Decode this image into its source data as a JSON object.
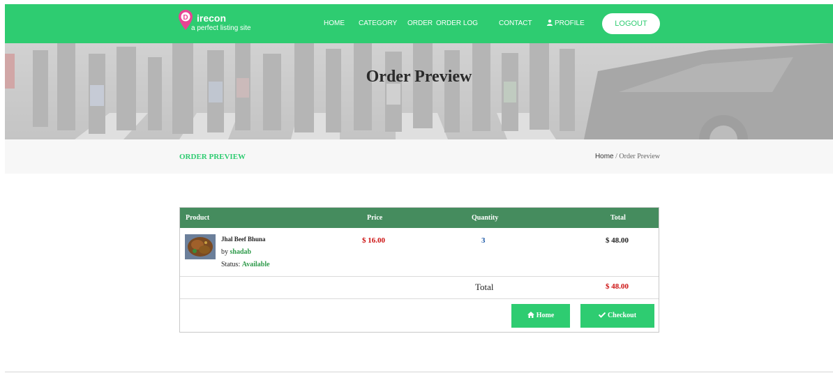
{
  "colors": {
    "brand": "#2ecc71",
    "table_header": "#458c5e",
    "price_red": "#cc1111",
    "qty_blue": "#1a57a6"
  },
  "brand": {
    "logo_letter": "D",
    "name": "irecon",
    "tagline": "a perfect listing site"
  },
  "nav": {
    "items": [
      {
        "label": "HOME"
      },
      {
        "label": "CATEGORY"
      },
      {
        "label": "ORDER"
      },
      {
        "label": "ORDER LOG"
      },
      {
        "label": "CONTACT"
      },
      {
        "label": "PROFILE",
        "icon": "user-icon"
      }
    ],
    "logout_label": "LOGOUT"
  },
  "hero": {
    "title": "Order Preview"
  },
  "breadcrumb": {
    "section": "ORDER PREVIEW",
    "home": "Home",
    "separator": " / ",
    "current": "Order Preview"
  },
  "order": {
    "columns": [
      "Product",
      "Price",
      "Quantity",
      "Total"
    ],
    "item": {
      "name": "Jhal Beef Bhuna",
      "by_label": "by",
      "seller": "shadab",
      "status_label": "Status:",
      "status": "Available",
      "price": "$ 16.00",
      "quantity": "3",
      "total": "$ 48.00"
    },
    "total_label": "Total",
    "grand_total": "$ 48.00",
    "buttons": {
      "home": "Home",
      "checkout": "Checkout"
    }
  }
}
